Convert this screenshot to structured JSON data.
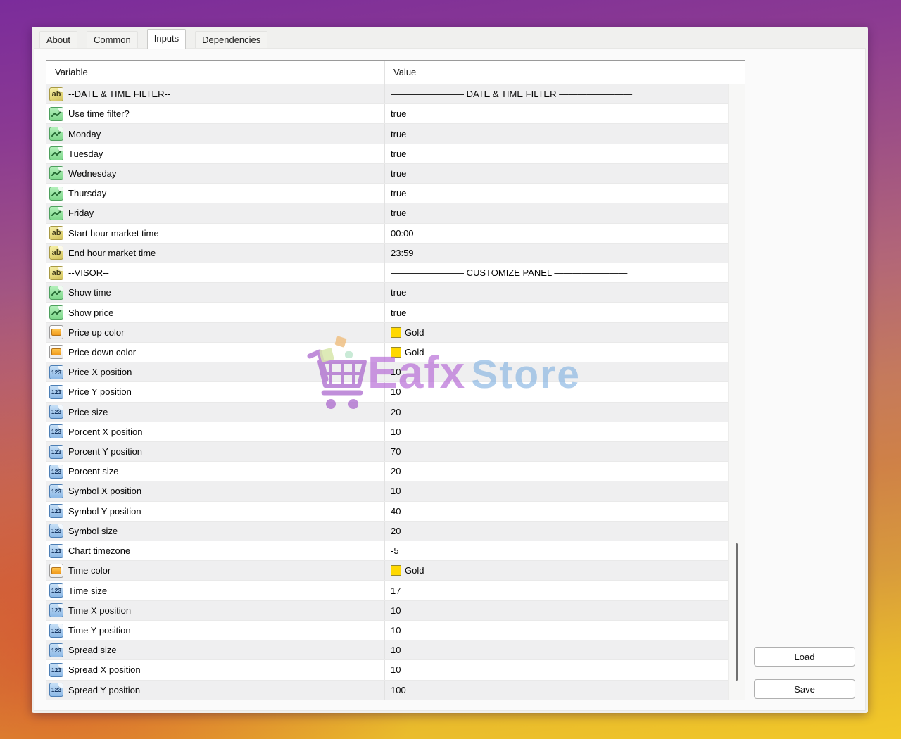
{
  "tabs": [
    {
      "label": "About",
      "active": false
    },
    {
      "label": "Common",
      "active": false
    },
    {
      "label": "Inputs",
      "active": true
    },
    {
      "label": "Dependencies",
      "active": false
    }
  ],
  "table": {
    "columns": [
      "Variable",
      "Value"
    ],
    "rows": [
      {
        "type": "string",
        "label": "--DATE & TIME FILTER--",
        "value": "———————— DATE & TIME FILTER ————————"
      },
      {
        "type": "bool",
        "label": "Use time filter?",
        "value": "true"
      },
      {
        "type": "bool",
        "label": "Monday",
        "value": "true"
      },
      {
        "type": "bool",
        "label": "Tuesday",
        "value": "true"
      },
      {
        "type": "bool",
        "label": "Wednesday",
        "value": "true"
      },
      {
        "type": "bool",
        "label": "Thursday",
        "value": "true"
      },
      {
        "type": "bool",
        "label": "Friday",
        "value": "true"
      },
      {
        "type": "string",
        "label": "Start hour market time",
        "value": "00:00"
      },
      {
        "type": "string",
        "label": "End hour market time",
        "value": "23:59"
      },
      {
        "type": "string",
        "label": "--VISOR--",
        "value": "———————— CUSTOMIZE PANEL ————————"
      },
      {
        "type": "bool",
        "label": "Show time",
        "value": "true"
      },
      {
        "type": "bool",
        "label": "Show price",
        "value": "true"
      },
      {
        "type": "color",
        "label": "Price up color",
        "value": "Gold"
      },
      {
        "type": "color",
        "label": "Price down color",
        "value": "Gold"
      },
      {
        "type": "number",
        "label": "Price X position",
        "value": "10"
      },
      {
        "type": "number",
        "label": "Price Y position",
        "value": "10"
      },
      {
        "type": "number",
        "label": "Price size",
        "value": "20"
      },
      {
        "type": "number",
        "label": "Porcent X position",
        "value": "10"
      },
      {
        "type": "number",
        "label": "Porcent Y position",
        "value": "70"
      },
      {
        "type": "number",
        "label": "Porcent size",
        "value": "20"
      },
      {
        "type": "number",
        "label": "Symbol X position",
        "value": "10"
      },
      {
        "type": "number",
        "label": "Symbol Y position",
        "value": "40"
      },
      {
        "type": "number",
        "label": "Symbol size",
        "value": "20"
      },
      {
        "type": "number",
        "label": "Chart timezone",
        "value": "-5"
      },
      {
        "type": "color",
        "label": "Time color",
        "value": "Gold"
      },
      {
        "type": "number",
        "label": "Time size",
        "value": "17"
      },
      {
        "type": "number",
        "label": "Time X position",
        "value": "10"
      },
      {
        "type": "number",
        "label": "Time Y position",
        "value": "10"
      },
      {
        "type": "number",
        "label": "Spread size",
        "value": "10"
      },
      {
        "type": "number",
        "label": "Spread X position",
        "value": "10"
      },
      {
        "type": "number",
        "label": "Spread Y position",
        "value": "100"
      }
    ]
  },
  "buttons": {
    "load": "Load",
    "save": "Save"
  },
  "watermark": {
    "first": "Eafx",
    "second": "Store"
  },
  "icon_glyphs": {
    "string": "ab",
    "number": "123"
  },
  "icons": {
    "string": "ab-badge-icon",
    "bool": "checkmark-page-icon",
    "number": "123-badge-icon",
    "color": "color-swatch-page-icon"
  },
  "colors": {
    "gold_swatch": "#FFD800",
    "accent_purple": "#7C2F9A",
    "watermark_purple": "#B668D5",
    "watermark_blue": "#80B0E0"
  }
}
